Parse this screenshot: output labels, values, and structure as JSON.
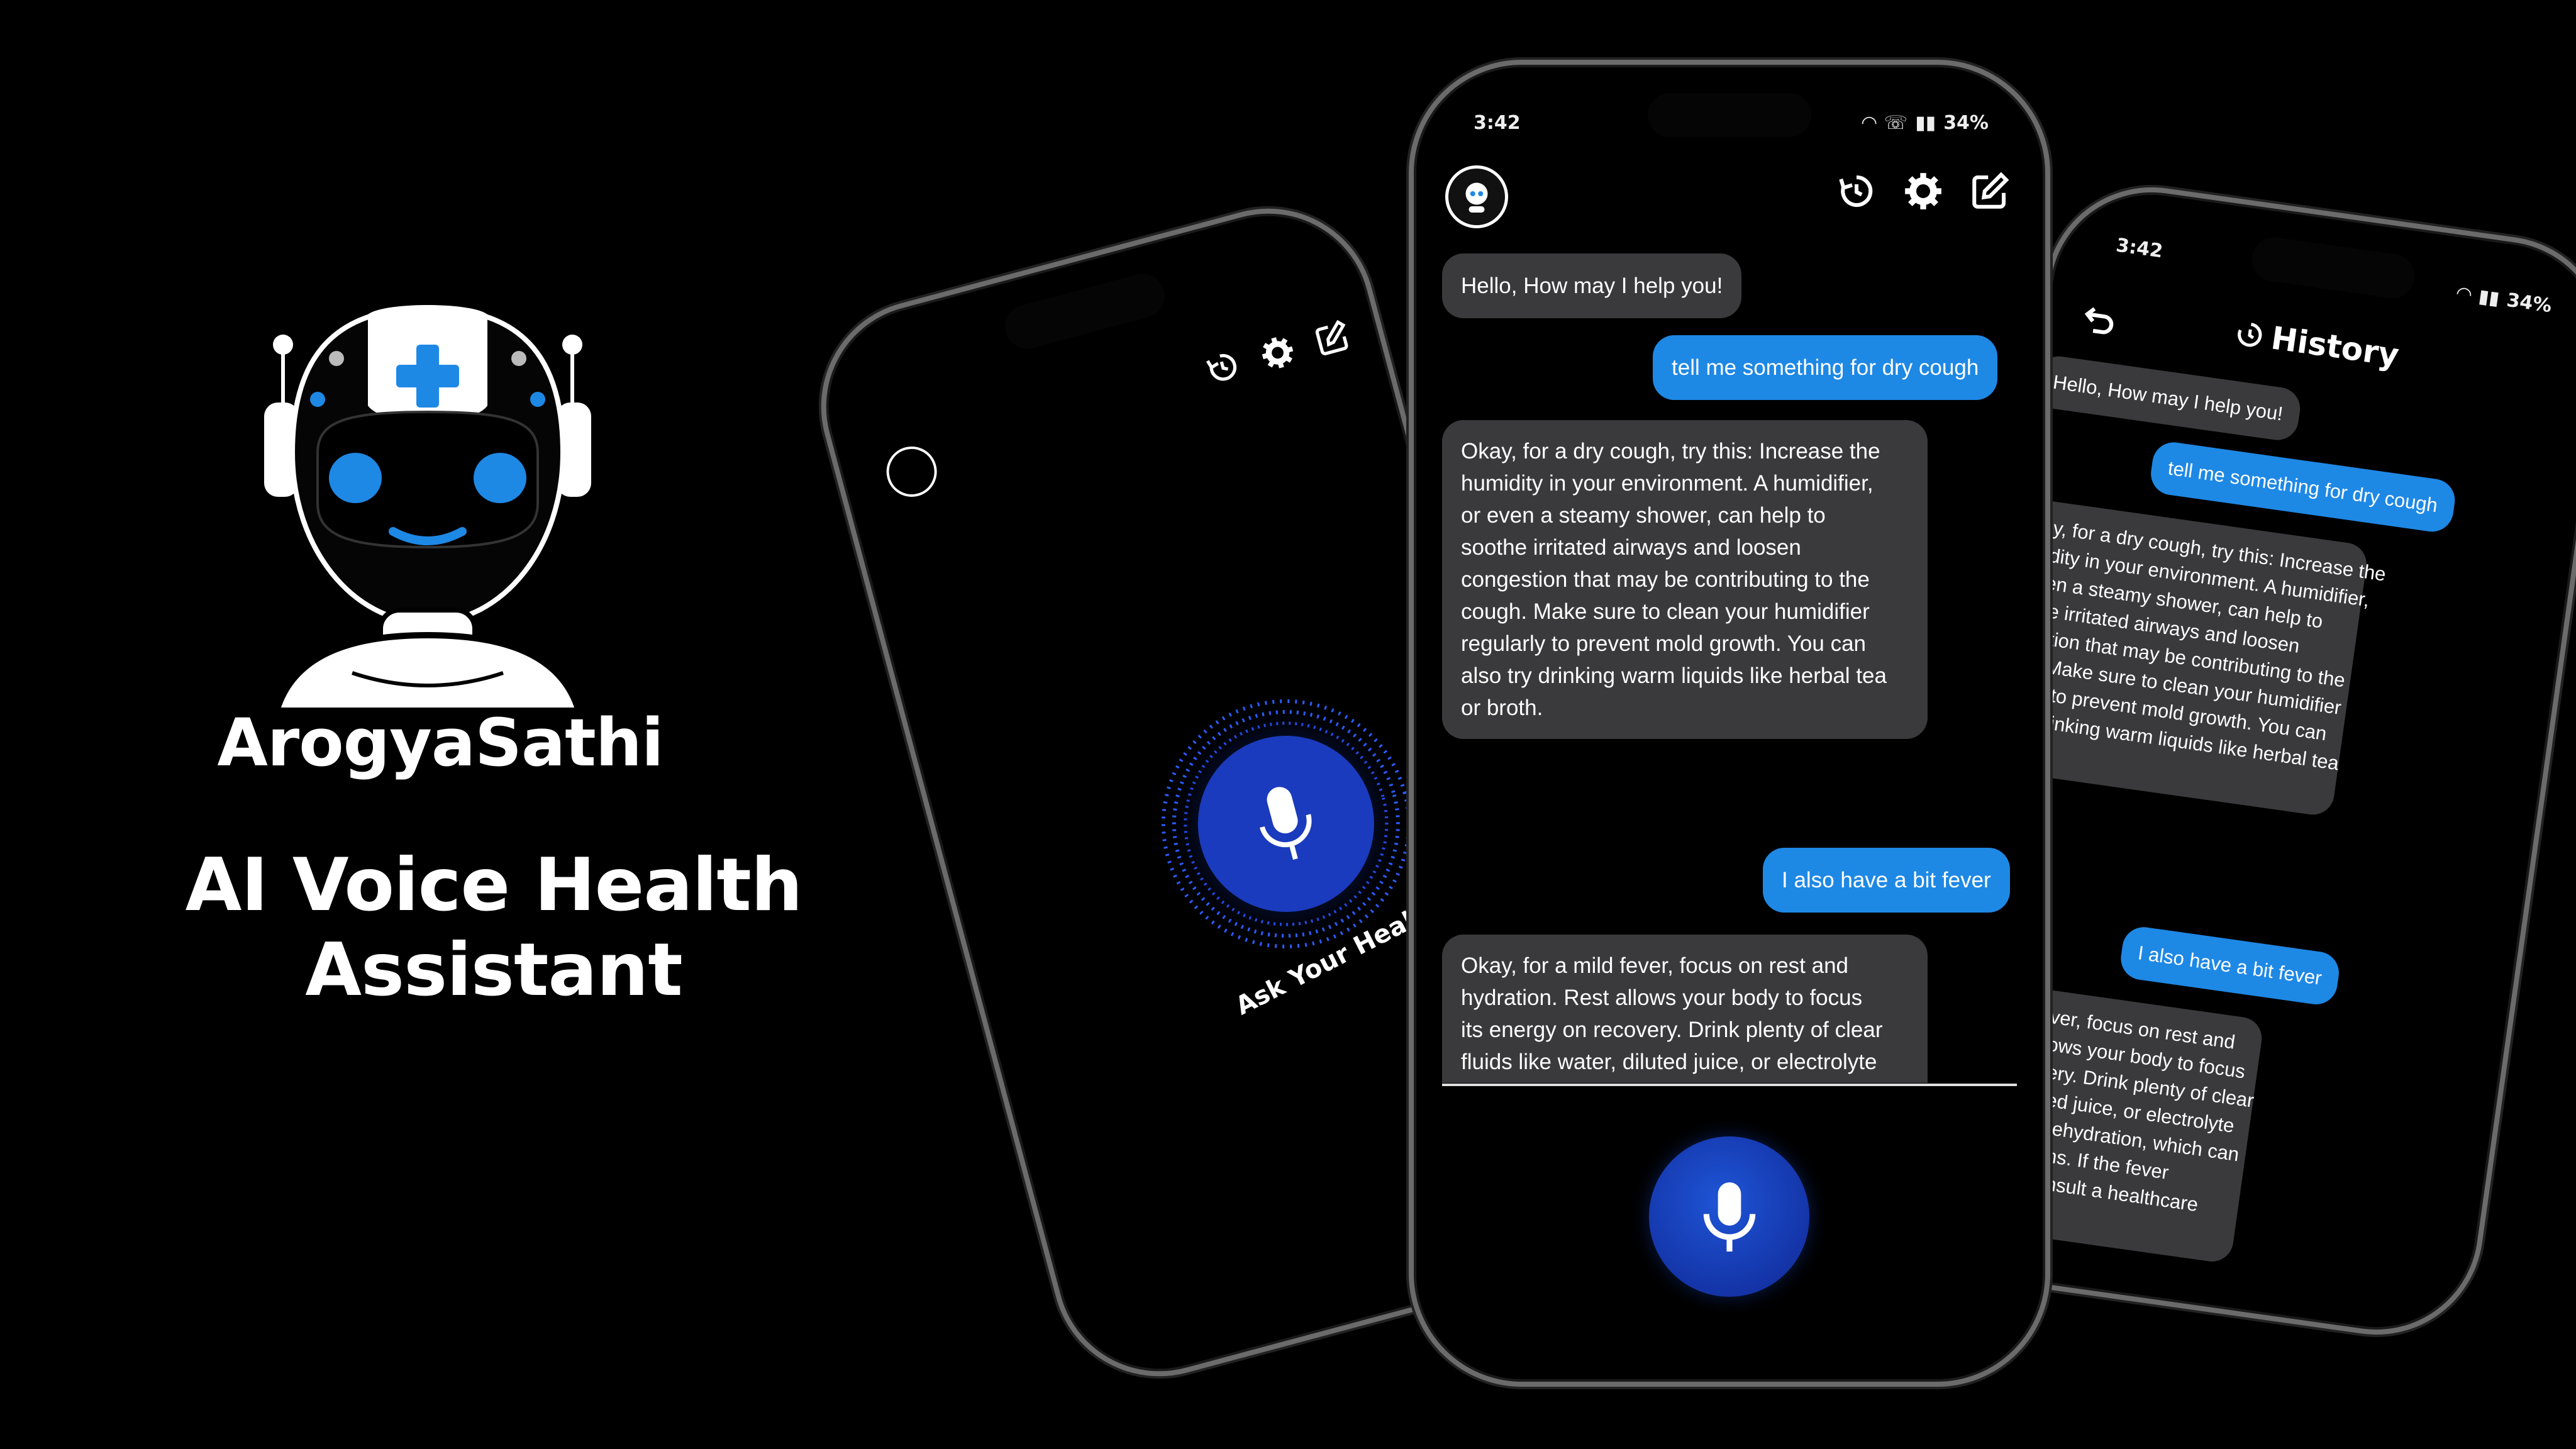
{
  "brand": {
    "name": "ArogyaSathi",
    "tagline": "AI Voice Health Assistant"
  },
  "colors": {
    "accent_blue": "#1e88e5",
    "mic_blue": "#1434a8",
    "bot_bubble": "#3a3a3c",
    "background": "#000000"
  },
  "left_phone": {
    "icons": [
      "avatar-icon",
      "history-icon",
      "gear-icon",
      "edit-icon"
    ],
    "caption": "Ask Your Health Queries"
  },
  "center_phone": {
    "status": {
      "time": "3:42",
      "battery": "34%"
    },
    "icons": [
      "avatar-icon",
      "history-icon",
      "gear-icon",
      "edit-icon",
      "mic-icon"
    ],
    "messages": [
      {
        "role": "bot",
        "text": "Hello, How may I help you!"
      },
      {
        "role": "user",
        "text": "tell me something for dry cough"
      },
      {
        "role": "bot",
        "lines": [
          "Okay, for a dry cough, try this: Increase the",
          "humidity in your environment. A humidifier,",
          "or even a steamy shower, can help to",
          "soothe irritated airways and loosen",
          "congestion that may be contributing to the",
          "cough. Make sure to clean your humidifier",
          "regularly to prevent mold growth. You can",
          "also try drinking warm liquids like herbal tea",
          "or broth."
        ]
      },
      {
        "role": "user",
        "text": "I also have a bit fever"
      },
      {
        "role": "bot",
        "lines": [
          "Okay, for a mild fever, focus on rest and",
          "hydration. Rest allows your body to focus",
          "its energy on recovery. Drink plenty of clear",
          "fluids like water, diluted juice, or electrolyte",
          "solutions to prevent dehydration, which can",
          "worsen fever symptoms. If the fever"
        ]
      }
    ]
  },
  "right_phone": {
    "status": {
      "time": "3:42",
      "battery": "34%"
    },
    "title": "History",
    "icons": [
      "back-icon",
      "history-icon"
    ],
    "messages": [
      {
        "role": "bot",
        "text": "Hello, How may I help you!"
      },
      {
        "role": "user",
        "text": "tell me something for dry cough"
      },
      {
        "role": "bot",
        "lines": [
          "kay, for a dry cough, try this: Increase the",
          "midity in your environment. A humidifier,",
          "even a steamy shower, can help to",
          "othe irritated airways and loosen",
          "gestion that may be contributing to the",
          "gh. Make sure to clean your humidifier",
          "larly to prevent mold growth. You can",
          "try drinking warm liquids like herbal tea",
          "oth."
        ]
      },
      {
        "role": "user",
        "text": "I also have a bit fever"
      },
      {
        "role": "bot",
        "lines": [
          "r a mild fever, focus on rest and",
          "n. Rest allows your body to focus",
          "y on recovery. Drink plenty of clear",
          "water, diluted juice, or electrolyte",
          "to prevent dehydration, which can",
          "ver symptoms. If the fever",
          "worsens, consult a healthcare",
          "al."
        ]
      }
    ]
  }
}
